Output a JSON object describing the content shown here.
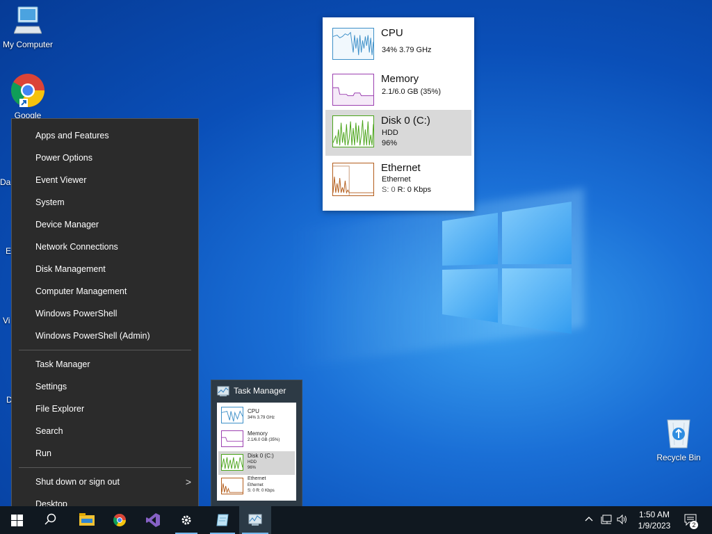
{
  "desktop": {
    "icons": [
      {
        "label": "My Computer"
      },
      {
        "label": "Google"
      },
      {
        "label": "Recycle Bin"
      }
    ],
    "partial_labels": [
      "Da",
      "E",
      "Vi",
      "D"
    ]
  },
  "winx_menu": {
    "group1": [
      "Apps and Features",
      "Power Options",
      "Event Viewer",
      "System",
      "Device Manager",
      "Network Connections",
      "Disk Management",
      "Computer Management",
      "Windows PowerShell",
      "Windows PowerShell (Admin)"
    ],
    "group2": [
      "Task Manager",
      "Settings",
      "File Explorer",
      "Search",
      "Run"
    ],
    "group3": [
      "Shut down or sign out",
      "Desktop"
    ],
    "submenu_arrow": ">"
  },
  "perf_popup": {
    "cpu": {
      "title": "CPU",
      "line1": "34% 3.79 GHz",
      "color": "#3c8fc8"
    },
    "memory": {
      "title": "Memory",
      "line1": "2.1/6.0 GB (35%)",
      "color": "#9b3fb0"
    },
    "disk": {
      "title": "Disk 0 (C:)",
      "line1": "HDD",
      "line2": "96%",
      "color": "#4aa41a"
    },
    "ethernet": {
      "title": "Ethernet",
      "line1": "Ethernet",
      "line2_s": "S: 0",
      "line2_r": "R: 0 Kbps",
      "color": "#b35c1a"
    }
  },
  "thumbnail": {
    "title": "Task Manager"
  },
  "taskbar": {
    "time": "1:50 AM",
    "date": "1/9/2023",
    "notifications": "2"
  }
}
